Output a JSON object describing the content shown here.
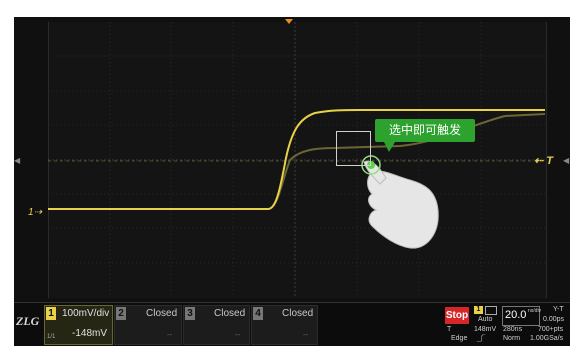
{
  "channel_bar": {
    "ch1": {
      "number": "1",
      "scale": "100mV/div",
      "offset": "-148mV",
      "sub": "1/1"
    },
    "ch2": {
      "number": "2",
      "status": "Closed",
      "value": "--"
    },
    "ch3": {
      "number": "3",
      "status": "Closed",
      "value": "--"
    },
    "ch4": {
      "number": "4",
      "status": "Closed",
      "value": "--"
    }
  },
  "trigger": {
    "run_state": "Stop",
    "mode_badge": "1",
    "mode": "Auto",
    "source_label": "T",
    "level": "148mV",
    "type": "Edge"
  },
  "timebase": {
    "scale": "20.0",
    "unit": "ns/div",
    "memory": "280ns",
    "acq_mode": "Norm",
    "display_mode": "Y-T",
    "delay": "0.00ps",
    "points": "700+pts",
    "sample_rate": "1.00GSa/s"
  },
  "screen": {
    "ch1_marker": "1",
    "trigger_marker": "T",
    "callout": "选中即可触发"
  },
  "colors": {
    "ch1": "#e8d24a",
    "callout": "#2ea22e",
    "stop": "#d6262a",
    "trigger_arrow": "#f08c1c"
  }
}
